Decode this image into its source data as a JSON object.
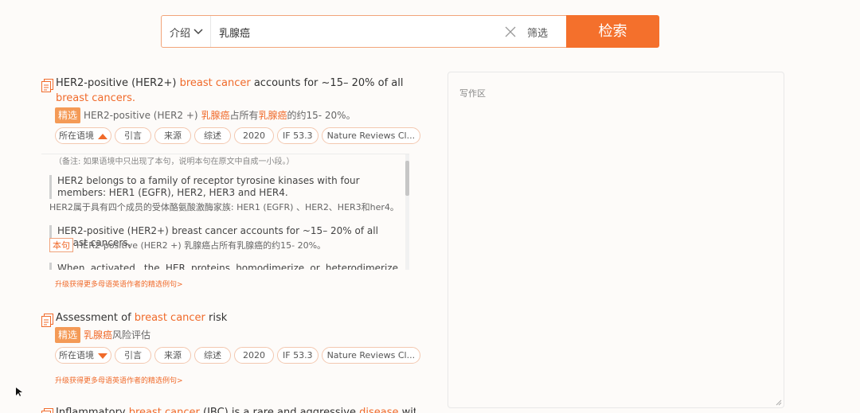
{
  "search": {
    "type_label": "介绍",
    "query": "乳腺癌",
    "filter_label": "筛选",
    "search_label": "检索"
  },
  "results": [
    {
      "en": [
        {
          "t": "HER2-positive (HER2+) ",
          "h": false
        },
        {
          "t": "breast cancer",
          "h": true
        },
        {
          "t": " accounts for ~15– 20% of all ",
          "h": false
        },
        {
          "t": "breast cancers.",
          "h": true
        }
      ],
      "badge": "精选",
      "cn": [
        {
          "t": "HER2-positive (HER2 +) ",
          "h": false
        },
        {
          "t": "乳腺癌",
          "h": true
        },
        {
          "t": "占所有",
          "h": false
        },
        {
          "t": "乳腺癌",
          "h": true
        },
        {
          "t": "的约15- 20%。",
          "h": false
        }
      ],
      "tags": {
        "context": "所在语境",
        "cite": "引言",
        "source": "来源",
        "review": "综述",
        "year": "2020",
        "if": "IF 53.3",
        "journal": "Nature Reviews Cl..."
      },
      "context_panel": {
        "note": "（备注: 如果语境中只出现了本句，说明本句在原文中自成一小段。）",
        "s1_en": "HER2 belongs to a family of receptor tyrosine kinases with four members: HER1 (EGFR), HER2, HER3 and HER4.",
        "s1_cn": "HER2属于具有四个成员的受体酪氨酸激酶家族: HER1 (EGFR) 、HER2、HER3和her4。",
        "s2_en": "HER2-positive (HER2+) breast cancer accounts for ~15– 20% of all breast cancers.",
        "s2_badge": "本句",
        "s2_cn": "HER2-positive (HER2 +) 乳腺癌占所有乳腺癌的约15- 20%。",
        "s3_en": "When activated, the HER proteins homodimerize or heterodimerize and"
      },
      "upgrade": "升级获得更多母语英语作者的精选例句>"
    },
    {
      "en": [
        {
          "t": "Assessment of ",
          "h": false
        },
        {
          "t": "breast cancer",
          "h": true
        },
        {
          "t": " risk",
          "h": false
        }
      ],
      "badge": "精选",
      "cn": [
        {
          "t": "乳腺癌",
          "h": true
        },
        {
          "t": "风险评估",
          "h": false
        }
      ],
      "tags": {
        "context": "所在语境",
        "cite": "引言",
        "source": "来源",
        "review": "综述",
        "year": "2020",
        "if": "IF 53.3",
        "journal": "Nature Reviews Cl..."
      },
      "upgrade": "升级获得更多母语英语作者的精选例句>"
    },
    {
      "en": [
        {
          "t": "Inflammatory ",
          "h": false
        },
        {
          "t": "breast cancer",
          "h": true
        },
        {
          "t": " (IBC) is a rare and aggressive ",
          "h": false
        },
        {
          "t": "disease",
          "h": true
        },
        {
          "t": " within",
          "h": false
        }
      ]
    }
  ],
  "writing": {
    "placeholder": "写作区"
  },
  "colors": {
    "accent": "#f4702c",
    "highlight": "#f06a2a",
    "badge": "#f49a56"
  }
}
